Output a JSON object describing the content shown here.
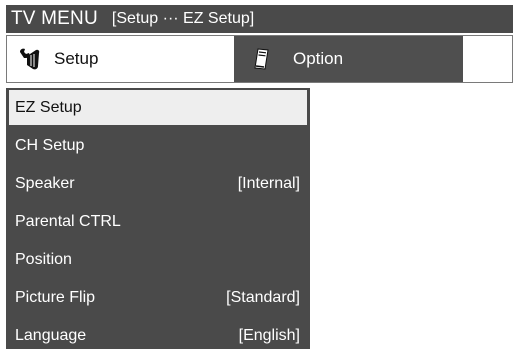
{
  "title_bar": {
    "title": "TV MENU",
    "path": "[Setup ··· EZ Setup]"
  },
  "tabs": [
    {
      "label": "Setup",
      "icon": "wrench-hand-icon",
      "active": true
    },
    {
      "label": "Option",
      "icon": "remote-card-icon",
      "active": false
    }
  ],
  "menu": {
    "items": [
      {
        "label": "EZ Setup",
        "value": "",
        "selected": true
      },
      {
        "label": "CH Setup",
        "value": ""
      },
      {
        "label": "Speaker",
        "value": "[Internal]"
      },
      {
        "label": "Parental CTRL",
        "value": ""
      },
      {
        "label": "Position",
        "value": ""
      },
      {
        "label": "Picture Flip",
        "value": "[Standard]"
      },
      {
        "label": "Language",
        "value": "[English]"
      }
    ]
  },
  "colors": {
    "title_bar_bg": "#4a4a4a",
    "menu_bg": "#4a4a4a",
    "selected_bg": "#eeeeee",
    "active_tab_bg": "#ffffff",
    "inactive_tab_bg": "#4f4f4f"
  }
}
